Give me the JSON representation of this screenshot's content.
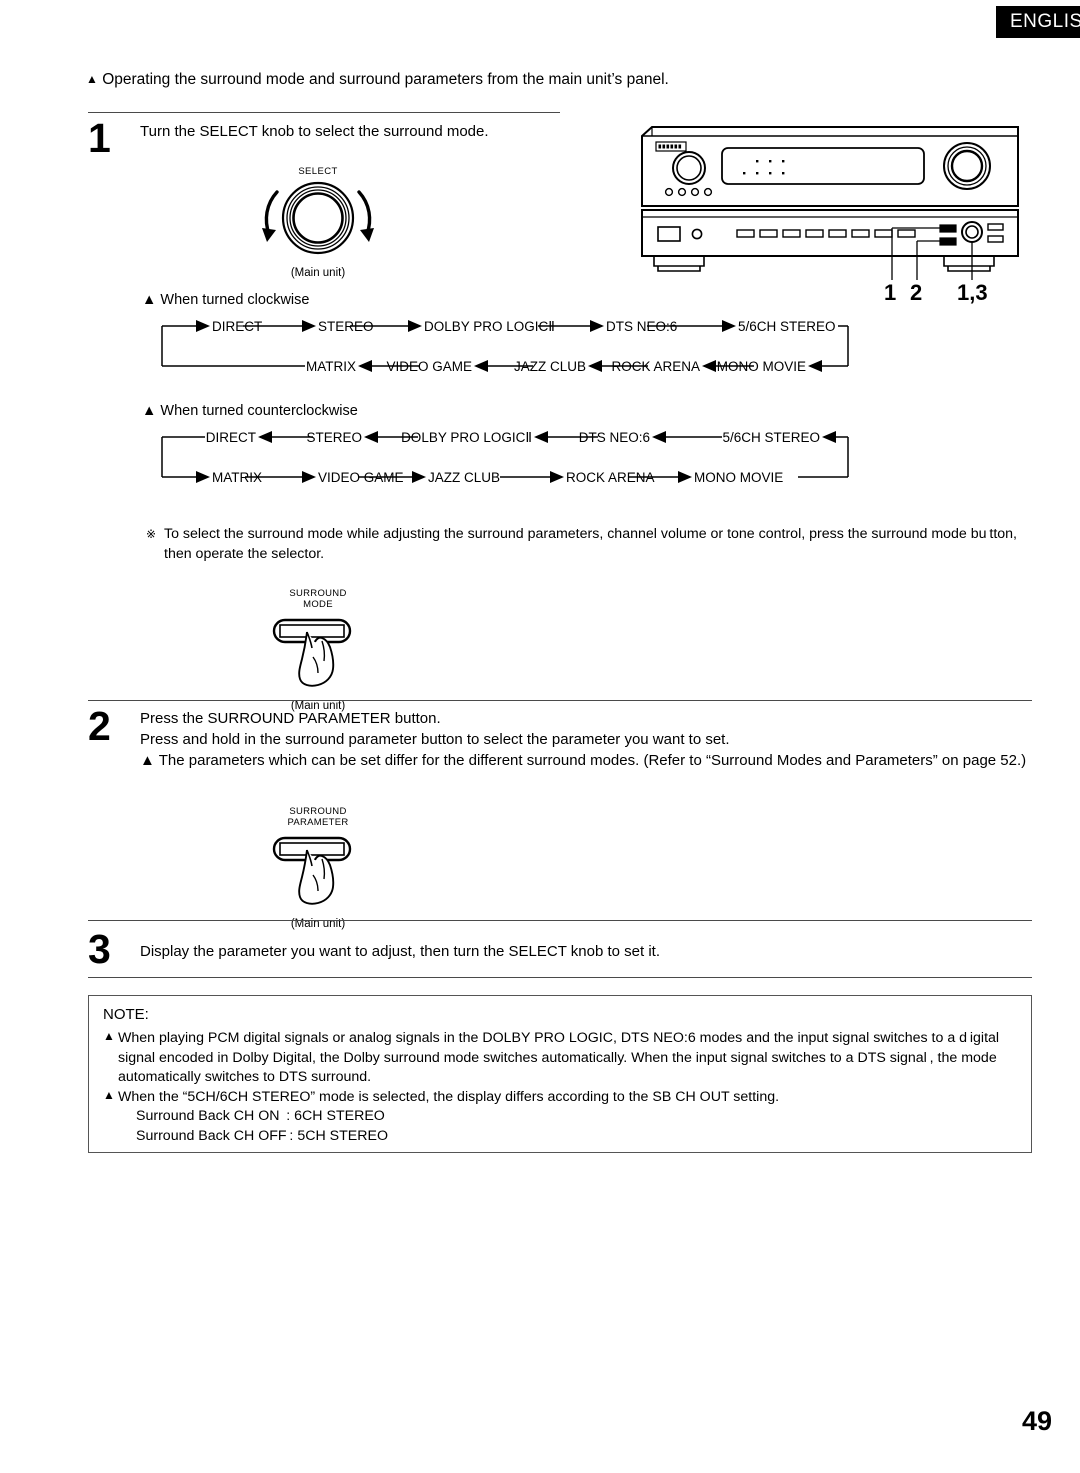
{
  "header": {
    "language_tab": "ENGLISH"
  },
  "intro": {
    "marker": "▲",
    "text": "Operating the surround mode and surround parameters from the main unit’s panel."
  },
  "steps": [
    {
      "number": "1",
      "lines": [
        "Turn the SELECT knob to select the surround mode."
      ]
    },
    {
      "number": "2",
      "lines": [
        "Press the SURROUND PARAMETER button.",
        "Press and hold in the surround parameter button to select the parameter you want to set.",
        "▲ The parameters which can be set differ for the different surround modes. (Refer to “Surround Modes and Parameters” on page 52.)"
      ]
    },
    {
      "number": "3",
      "lines": [
        "Display the parameter you want to adjust, then turn the SELECT knob to set it."
      ]
    }
  ],
  "knob_illustration": {
    "label": "SELECT",
    "caption": "(Main unit)"
  },
  "device": {
    "brand_badge": "DENON",
    "callouts": [
      "1",
      "2",
      "1,3"
    ]
  },
  "flowcharts": [
    {
      "title": "▲ When turned clockwise",
      "direction": "clockwise",
      "top_row": [
        "DIRECT",
        "STEREO",
        "DOLBY PRO LOGICⅡ",
        "DTS NEO:6",
        "5/6CH STEREO"
      ],
      "bottom_row": [
        "MATRIX",
        "VIDEO GAME",
        "JAZZ CLUB",
        "ROCK ARENA",
        "MONO MOVIE"
      ]
    },
    {
      "title": "▲ When turned counterclockwise",
      "direction": "counterclockwise",
      "top_row": [
        "DIRECT",
        "STEREO",
        "DOLBY PRO LOGICⅡ",
        "DTS NEO:6",
        "5/6CH STEREO"
      ],
      "bottom_row": [
        "MATRIX",
        "VIDEO GAME",
        "JAZZ CLUB",
        "ROCK ARENA",
        "MONO MOVIE"
      ]
    }
  ],
  "asterisk_note": {
    "marker": "※",
    "line1": "To select the surround mode while adjusting the surround parameters, channel volume or tone control, press the surround mode bu tton,",
    "line2": "then operate the selector."
  },
  "surround_mode_button": {
    "label_line1": "SURROUND",
    "label_line2": "MODE",
    "caption": "(Main unit)"
  },
  "surround_parameter_button": {
    "label_line1": "SURROUND",
    "label_line2": "PARAMETER",
    "caption": "(Main unit)"
  },
  "note": {
    "heading": "NOTE:",
    "items": [
      "When playing PCM digital signals or analog signals in the DOLBY PRO LOGIC, DTS NEO:6 modes and the input signal switches to a d igital signal encoded in Dolby Digital, the Dolby surround mode switches automatically. When the input signal switches to a DTS signal , the mode automatically switches to DTS surround.",
      "When the “5CH/6CH STEREO” mode is selected, the display differs according to the SB CH OUT setting."
    ],
    "sub_items": [
      "Surround Back CH ON  : 6CH STEREO",
      "Surround Back CH OFF : 5CH STEREO"
    ]
  },
  "page_number": "49"
}
